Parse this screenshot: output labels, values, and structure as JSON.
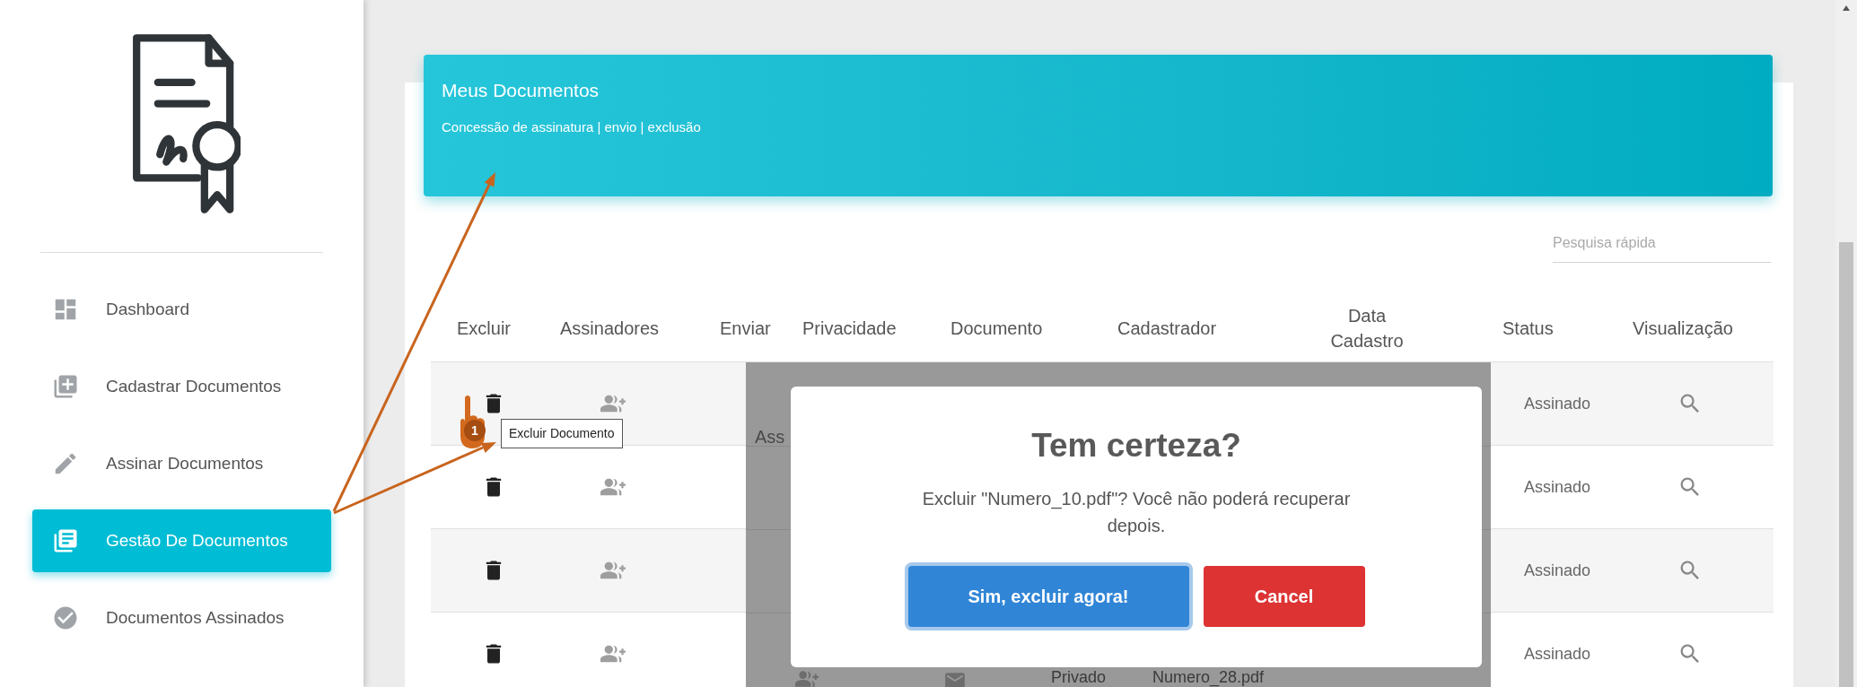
{
  "sidebar": {
    "items": [
      {
        "label": "Dashboard",
        "selected": false
      },
      {
        "label": "Cadastrar Documentos",
        "selected": false
      },
      {
        "label": "Assinar Documentos",
        "selected": false
      },
      {
        "label": "Gestão De Documentos",
        "selected": true
      },
      {
        "label": "Documentos Assinados",
        "selected": false
      }
    ]
  },
  "header": {
    "title": "Meus Documentos",
    "subtitle": "Concessão de assinatura | envio | exclusão"
  },
  "search": {
    "placeholder": "Pesquisa rápida"
  },
  "table": {
    "columns": [
      "Excluir",
      "Assinadores",
      "Enviar",
      "Privacidade",
      "Documento",
      "Cadastrador",
      "Data Cadastro",
      "Status",
      "Visualização"
    ],
    "rows": [
      {
        "status": "Assinado"
      },
      {
        "status": "Assinado"
      },
      {
        "status": "Assinado"
      },
      {
        "status": "Assinado"
      }
    ]
  },
  "tooltip": {
    "text": "Excluir Documento"
  },
  "step_badge": "1",
  "dialog": {
    "behind": {
      "heading": "Ass",
      "privacy": "Privado",
      "document": "Numero_28.pdf"
    },
    "title": "Tem certeza?",
    "message": "Excluir \"Numero_10.pdf\"? Você não poderá recuperar depois.",
    "buttons": [
      {
        "label": "Sim, excluir agora!",
        "kind": "confirm"
      },
      {
        "label": "Cancel",
        "kind": "cancel"
      }
    ]
  }
}
